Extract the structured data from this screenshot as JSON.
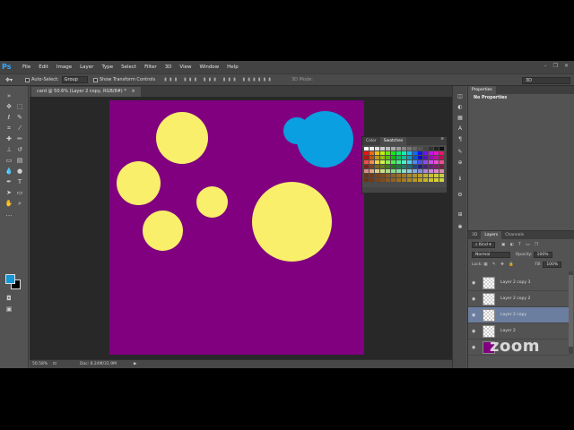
{
  "app": {
    "logo": "Ps"
  },
  "menu": [
    "File",
    "Edit",
    "Image",
    "Layer",
    "Type",
    "Select",
    "Filter",
    "3D",
    "View",
    "Window",
    "Help"
  ],
  "options": {
    "auto_select_label": "Auto-Select:",
    "auto_select_value": "Group",
    "transform_label": "Show Transform Controls",
    "mode_3d_label": "3D Mode:",
    "workspace_value": "3D"
  },
  "document": {
    "tab_title": "card @ 50.6% (Layer 2 copy, RGB/8#) *",
    "canvas_color": "#800080",
    "zoom_status": "50.58%",
    "doc_status": "Doc: 8.24M/31.9M",
    "shapes": [
      {
        "name": "yellow-circle",
        "color": "#f9ef6b"
      },
      {
        "name": "yellow-circle",
        "color": "#f9ef6b"
      },
      {
        "name": "yellow-circle",
        "color": "#f9ef6b"
      },
      {
        "name": "yellow-circle",
        "color": "#f9ef6b"
      },
      {
        "name": "yellow-circle",
        "color": "#f9ef6b"
      },
      {
        "name": "blue-circle",
        "color": "#0a9fe0"
      },
      {
        "name": "blue-circle",
        "color": "#0a9fe0"
      }
    ]
  },
  "swatches_panel": {
    "tabs": [
      "Color",
      "Swatches"
    ],
    "active_tab": "Swatches"
  },
  "tools": {
    "foreground_color": "#1597d6",
    "background_color": "#000000"
  },
  "properties_panel": {
    "tab": "Properties",
    "title": "No Properties"
  },
  "layers_panel": {
    "tabs": [
      "3D",
      "Layers",
      "Channels"
    ],
    "active_tab": "Layers",
    "filter_value": "Kind",
    "blend_mode": "Normal",
    "opacity_label": "Opacity:",
    "opacity_value": "100%",
    "lock_label": "Lock:",
    "fill_label": "Fill:",
    "fill_value": "100%",
    "layers": [
      {
        "name": "Layer 2 copy 3",
        "selected": false
      },
      {
        "name": "Layer 2 copy 2",
        "selected": false
      },
      {
        "name": "Layer 2 copy",
        "selected": true
      },
      {
        "name": "Layer 2",
        "selected": false
      },
      {
        "name": "",
        "selected": false
      }
    ]
  },
  "watermark": "zoom"
}
